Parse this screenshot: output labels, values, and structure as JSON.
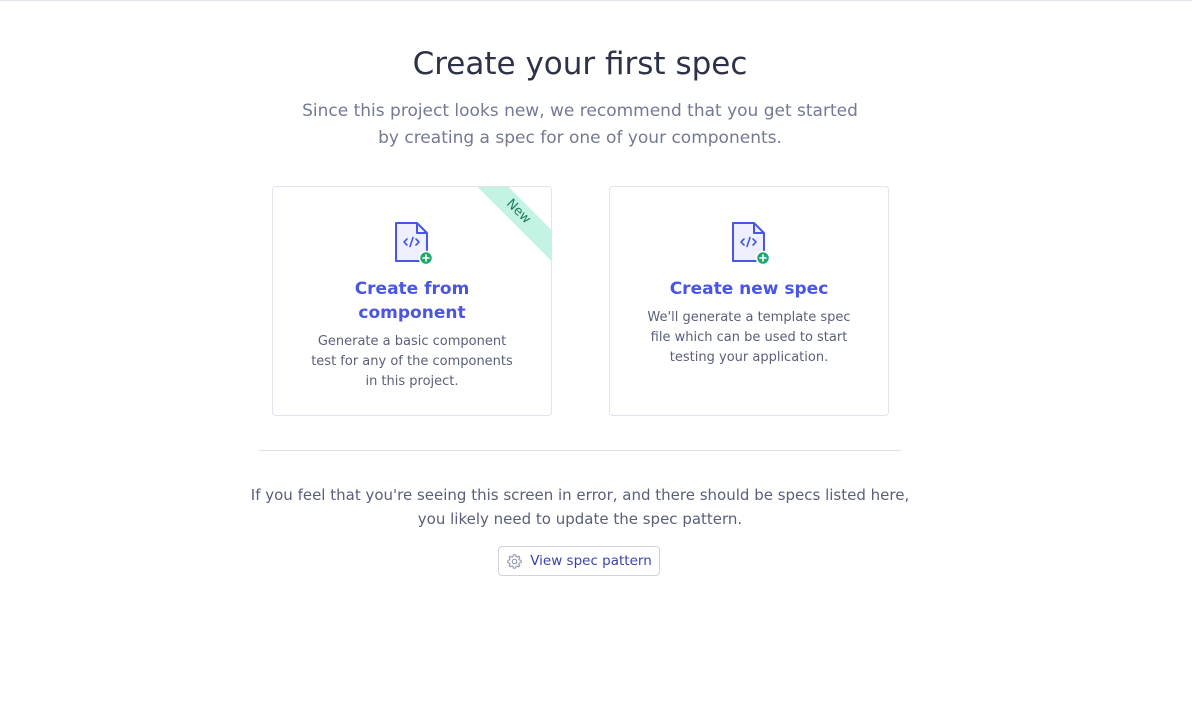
{
  "header": {
    "title": "Create your first spec",
    "subtitle": "Since this project looks new, we recommend that you get started by creating a spec for one of your components."
  },
  "cards": [
    {
      "title": "Create from component",
      "description": "Generate a basic component test for any of the components in this project.",
      "badge": "New",
      "icon": "document-code-add-icon"
    },
    {
      "title": "Create new spec",
      "description": "We'll generate a template spec file which can be used to start testing your application.",
      "icon": "document-code-add-icon"
    }
  ],
  "footer": {
    "message": "If you feel that you're seeing this screen in error, and there should be specs listed here, you likely need to update the spec pattern.",
    "button_label": "View spec pattern",
    "button_icon": "gear-icon"
  },
  "colors": {
    "accent": "#4956e3",
    "badge_bg": "#c2f3e3",
    "badge_text": "#1f7a5b",
    "plus_green": "#1fa971"
  }
}
